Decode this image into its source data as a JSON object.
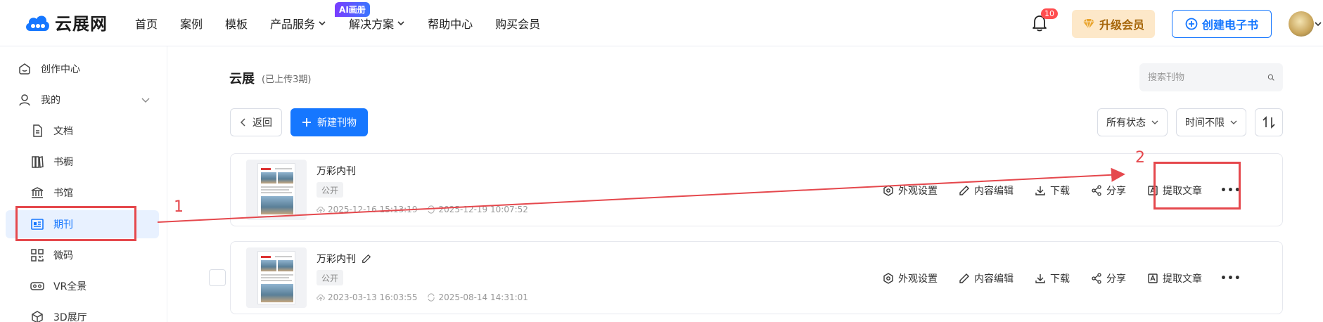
{
  "header": {
    "logo_text": "云展网",
    "nav": [
      {
        "label": "首页"
      },
      {
        "label": "案例"
      },
      {
        "label": "模板"
      },
      {
        "label": "产品服务"
      },
      {
        "label": "解决方案"
      },
      {
        "label": "帮助中心"
      },
      {
        "label": "购买会员"
      }
    ],
    "ai_badge": "AI画册",
    "notification_count": "10",
    "upgrade_label": "升级会员",
    "create_label": "创建电子书"
  },
  "sidebar": {
    "items": [
      {
        "label": "创作中心",
        "icon": "home-icon"
      },
      {
        "label": "我的",
        "icon": "user-icon"
      },
      {
        "label": "文档",
        "icon": "document-icon"
      },
      {
        "label": "书橱",
        "icon": "bookshelf-icon"
      },
      {
        "label": "书馆",
        "icon": "library-icon"
      },
      {
        "label": "期刊",
        "icon": "periodical-icon",
        "active": true
      },
      {
        "label": "微码",
        "icon": "qrcode-icon"
      },
      {
        "label": "VR全景",
        "icon": "vr-icon"
      },
      {
        "label": "3D展厅",
        "icon": "cube-icon"
      }
    ]
  },
  "main": {
    "title": "云展",
    "subtitle": "(已上传3期)",
    "search_placeholder": "搜索刊物",
    "back_label": "返回",
    "new_label": "新建刊物",
    "filter_status": "所有状态",
    "filter_time": "时间不限",
    "cards": [
      {
        "title": "万彩内刊",
        "tag": "公开",
        "created": "2025-12-16 15:13:19",
        "updated": "2025-12-19 10:07:52"
      },
      {
        "title": "万彩内刊",
        "tag": "公开",
        "created": "2023-03-13 16:03:55",
        "updated": "2025-08-14 14:31:01"
      }
    ],
    "actions": {
      "appearance": "外观设置",
      "edit": "内容编辑",
      "download": "下载",
      "share": "分享",
      "extract": "提取文章",
      "more": "•••"
    }
  },
  "annotations": {
    "label_1": "1",
    "label_2": "2",
    "color": "#e5484d"
  }
}
